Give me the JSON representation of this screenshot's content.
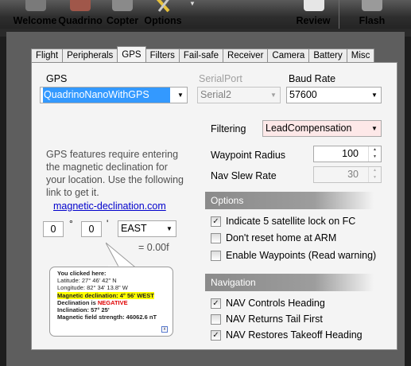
{
  "toolbar": {
    "buttons": [
      {
        "label": "Welcome"
      },
      {
        "label": "Quadrino"
      },
      {
        "label": "Copter"
      },
      {
        "label": "Options"
      },
      {
        "label": "Review"
      },
      {
        "label": "Flash"
      }
    ]
  },
  "tabs": [
    "Flight",
    "Peripherals",
    "GPS",
    "Filters",
    "Fail-safe",
    "Receiver",
    "Camera",
    "Battery",
    "Misc"
  ],
  "active_tab": "GPS",
  "gps": {
    "label": "GPS",
    "value": "QuadrinoNanoWithGPS"
  },
  "serial_port": {
    "label": "SerialPort",
    "value": "Serial2"
  },
  "baud_rate": {
    "label": "Baud Rate",
    "value": "57600"
  },
  "filtering": {
    "label": "Filtering",
    "value": "LeadCompensation"
  },
  "waypoint_radius": {
    "label": "Waypoint Radius",
    "value": "100"
  },
  "nav_slew_rate": {
    "label": "Nav Slew Rate",
    "value": "30"
  },
  "info_text": "GPS features require entering the magnetic declination for your location. Use the following link to get it.",
  "link_text": "magnetic-declination.com",
  "declination": {
    "degrees": "0",
    "degree_symbol": "°",
    "minutes": "0",
    "minute_symbol": "'",
    "direction": "EAST",
    "result": "= 0.00f"
  },
  "balloon": {
    "line1": "You clicked here:",
    "line2": "Latitude: 27° 46' 42\" N",
    "line3": "Longitude: 82° 34' 13.8\" W",
    "line4": "Magnetic declination: 4° 56' WEST",
    "line5a": "Declination is ",
    "line5b": "NEGATIVE",
    "line6": "Inclination: 57° 25'",
    "line7": "Magnetic field strength: 46062.6 nT",
    "close": "x"
  },
  "options": {
    "header": "Options",
    "items": [
      {
        "label": "Indicate 5 satellite lock on FC",
        "checked": true
      },
      {
        "label": "Don't reset home at ARM",
        "checked": false
      },
      {
        "label": "Enable Waypoints (Read warning)",
        "checked": false
      }
    ]
  },
  "navigation": {
    "header": "Navigation",
    "items": [
      {
        "label": "NAV Controls Heading",
        "checked": true
      },
      {
        "label": "NAV Returns Tail First",
        "checked": false
      },
      {
        "label": "NAV Restores Takeoff Heading",
        "checked": true
      }
    ]
  },
  "glyphs": {
    "dropdown": "▼",
    "check": "✓",
    "up": "▲",
    "down": "▼"
  },
  "colors": {
    "selection": "#3399ff",
    "filtering_bg": "#fde8e8",
    "highlight": "#ffff00",
    "negative": "#e00000"
  }
}
